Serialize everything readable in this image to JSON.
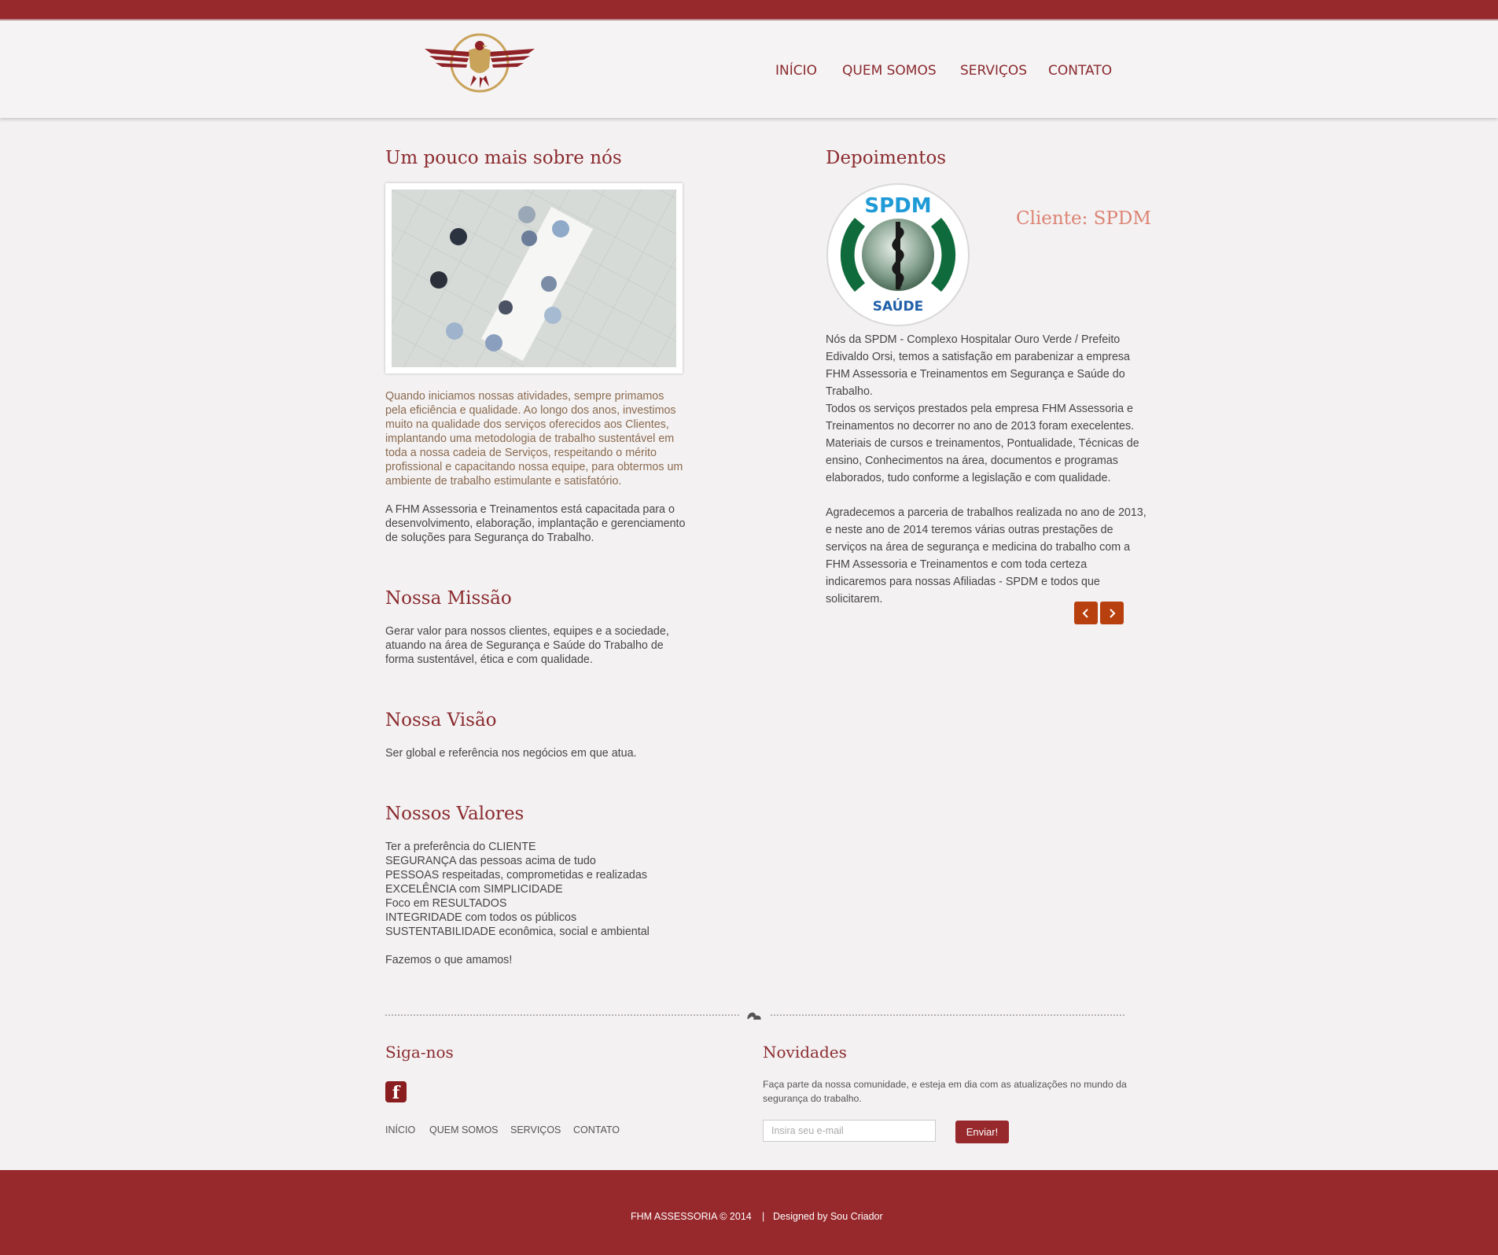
{
  "nav": {
    "items": [
      {
        "label": "INÍCIO"
      },
      {
        "label": "QUEM SOMOS"
      },
      {
        "label": "SERVIÇOS"
      },
      {
        "label": "CONTATO"
      }
    ]
  },
  "about": {
    "title": "Um pouco mais sobre nós",
    "intro": "Quando iniciamos nossas atividades, sempre primamos pela eficiência e qualidade. Ao longo dos anos, investimos muito na qualidade dos serviços oferecidos aos Clientes, implantando uma metodologia de trabalho sustentável em toda a nossa cadeia de Serviços, respeitando o mérito profissional e capacitando nossa equipe, para obtermos um ambiente de trabalho estimulante e satisfatório.",
    "body": "A FHM Assessoria e Treinamentos está capacitada para o desenvolvimento, elaboração, implantação e gerenciamento de soluções para Segurança do Trabalho."
  },
  "mission": {
    "title": "Nossa Missão",
    "text": "Gerar valor para nossos clientes, equipes e a sociedade, atuando na área de Segurança e Saúde do Trabalho de forma sustentável, ética e com qualidade."
  },
  "vision": {
    "title": "Nossa Visão",
    "text": "Ser global e referência nos negócios em que atua."
  },
  "values": {
    "title": "Nossos Valores",
    "items": [
      "Ter a preferência do CLIENTE",
      "SEGURANÇA das pessoas acima de tudo",
      "PESSOAS respeitadas, comprometidas e realizadas",
      "EXCELÊNCIA com SIMPLICIDADE",
      "Foco em RESULTADOS",
      "INTEGRIDADE com todos os públicos",
      "SUSTENTABILIDADE econômica, social e ambiental"
    ],
    "closing": "Fazemos o que amamos!"
  },
  "testimonials": {
    "title": "Depoimentos",
    "client": "Cliente: SPDM",
    "logo_text_top": "SPDM",
    "logo_text_bottom": "SAÚDE",
    "paragraph1": "Nós da SPDM - Complexo Hospitalar Ouro Verde / Prefeito Edivaldo Orsi, temos a satisfação em parabenizar a empresa FHM Assessoria e Treinamentos em Segurança e Saúde do Trabalho.",
    "paragraph2": "Todos os serviços prestados pela empresa FHM Assessoria e Treinamentos no decorrer no ano de 2013 foram execelentes. Materiais de cursos e treinamentos, Pontualidade, Técnicas de ensino, Conhecimentos na área, documentos e programas elaborados, tudo conforme a legislação e com qualidade.",
    "paragraph3": "Agradecemos a parceria de trabalhos realizada no ano de 2013, e neste ano de 2014 teremos várias outras prestações de serviços na área de segurança e medicina do trabalho com a FHM Assessoria e Treinamentos e com toda certeza indicaremos para nossas Afiliadas - SPDM e todos que solicitarem."
  },
  "follow": {
    "title": "Siga-nos",
    "facebook_glyph": "f",
    "links": [
      {
        "label": "INÍCIO"
      },
      {
        "label": "QUEM SOMOS"
      },
      {
        "label": "SERVIÇOS"
      },
      {
        "label": "CONTATO"
      }
    ]
  },
  "newsletter": {
    "title": "Novidades",
    "description": "Faça parte da nossa comunidade, e esteja em dia com as atualizações no mundo da segurança do trabalho.",
    "placeholder": "Insira seu e-mail",
    "button": "Enviar!"
  },
  "footer": {
    "copyright": "FHM ASSESSORIA © 2014",
    "separator": "|",
    "designed_by": "Designed by Sou Criador"
  },
  "colors": {
    "brand": "#97282c",
    "heading": "#8b2b2f",
    "accent_arrow": "#b8400f",
    "client_label": "#dc8473"
  }
}
